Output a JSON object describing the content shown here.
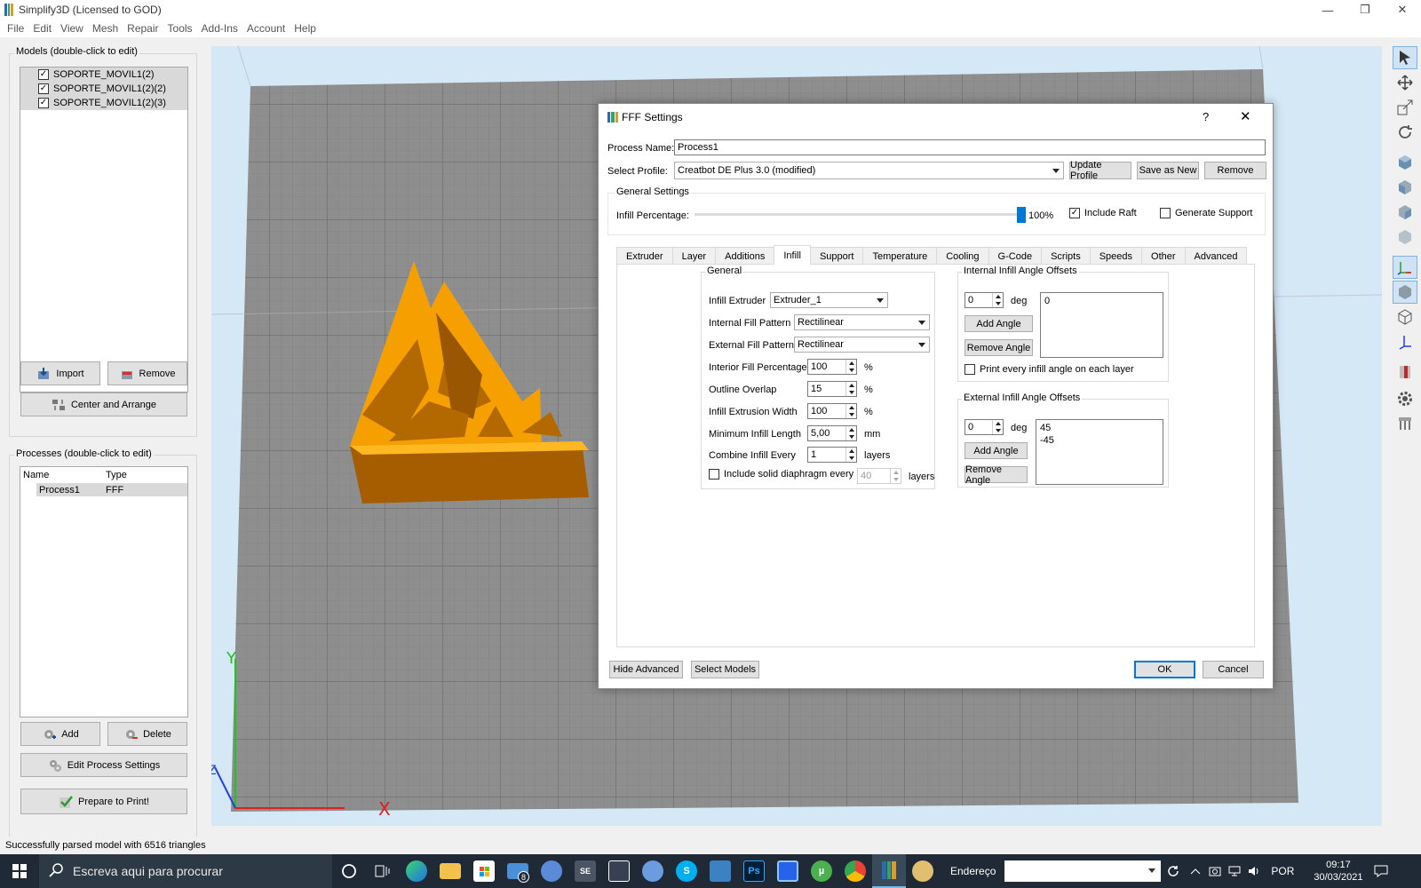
{
  "window": {
    "title": "Simplify3D (Licensed to GOD)",
    "controls": [
      "—",
      "❐",
      "✕"
    ]
  },
  "menu": [
    "File",
    "Edit",
    "View",
    "Mesh",
    "Repair",
    "Tools",
    "Add-Ins",
    "Account",
    "Help"
  ],
  "models": {
    "title": "Models (double-click to edit)",
    "items": [
      "SOPORTE_MOVIL1(2)",
      "SOPORTE_MOVIL1(2)(2)",
      "SOPORTE_MOVIL1(2)(3)"
    ],
    "import_label": "Import",
    "remove_label": "Remove",
    "center_label": "Center and Arrange"
  },
  "processes": {
    "title": "Processes (double-click to edit)",
    "col_name": "Name",
    "col_type": "Type",
    "rows": [
      {
        "name": "Process1",
        "type": "FFF"
      }
    ],
    "add_label": "Add",
    "delete_label": "Delete",
    "edit_label": "Edit Process Settings",
    "prepare_label": "Prepare to Print!"
  },
  "status": "Successfully parsed model with 6516 triangles",
  "axes": {
    "y": "Y",
    "z": "Z",
    "x": "X"
  },
  "dialog": {
    "title": "FFF Settings",
    "help": "?",
    "close": "✕",
    "process_name_label": "Process Name:",
    "process_name": "Process1",
    "select_profile_label": "Select Profile:",
    "profile": "Creatbot DE Plus 3.0 (modified)",
    "update_profile": "Update Profile",
    "save_as_new": "Save as New",
    "remove": "Remove",
    "general_settings": "General Settings",
    "infill_percentage_label": "Infill Percentage:",
    "infill_percentage": "100%",
    "infill_percentage_value": 1.0,
    "include_raft": "Include Raft",
    "include_raft_checked": true,
    "generate_support": "Generate Support",
    "generate_support_checked": false,
    "tabs": [
      "Extruder",
      "Layer",
      "Additions",
      "Infill",
      "Support",
      "Temperature",
      "Cooling",
      "G-Code",
      "Scripts",
      "Speeds",
      "Other",
      "Advanced"
    ],
    "active_tab": "Infill",
    "general": {
      "title": "General",
      "infill_extruder_label": "Infill Extruder",
      "infill_extruder": "Extruder_1",
      "internal_pattern_label": "Internal Fill Pattern",
      "internal_pattern": "Rectilinear",
      "external_pattern_label": "External Fill Pattern",
      "external_pattern": "Rectilinear",
      "interior_pct_label": "Interior Fill Percentage",
      "interior_pct": "100",
      "outline_overlap_label": "Outline Overlap",
      "outline_overlap": "15",
      "extrusion_width_label": "Infill Extrusion Width",
      "extrusion_width": "100",
      "min_length_label": "Minimum Infill Length",
      "min_length": "5,00",
      "combine_label": "Combine Infill Every",
      "combine": "1",
      "diaphragm_label": "Include solid diaphragm every",
      "diaphragm": "40",
      "unit_pct": "%",
      "unit_mm": "mm",
      "unit_layers": "layers"
    },
    "internal_offsets": {
      "title": "Internal Infill Angle Offsets",
      "value": "0",
      "unit": "deg",
      "list": [
        "0"
      ],
      "add": "Add Angle",
      "remove": "Remove Angle",
      "print_every": "Print every infill angle on each layer"
    },
    "external_offsets": {
      "title": "External Infill Angle Offsets",
      "value": "0",
      "unit": "deg",
      "list": [
        "45",
        "-45"
      ],
      "add": "Add Angle",
      "remove": "Remove Angle"
    },
    "hide_advanced": "Hide Advanced",
    "select_models": "Select Models",
    "ok": "OK",
    "cancel": "Cancel"
  },
  "taskbar": {
    "search_placeholder": "Escreva aqui para procurar",
    "address_label": "Endereço",
    "language": "POR",
    "time": "09:17",
    "date": "30/03/2021",
    "mail_badge": "8"
  },
  "colors": {
    "accent": "#0078d7",
    "model_orange": "#f5a000",
    "grid_gray": "#8e8e8e",
    "viewport_bg": "#d4e8f6",
    "taskbar_bg": "#1f2a36"
  }
}
